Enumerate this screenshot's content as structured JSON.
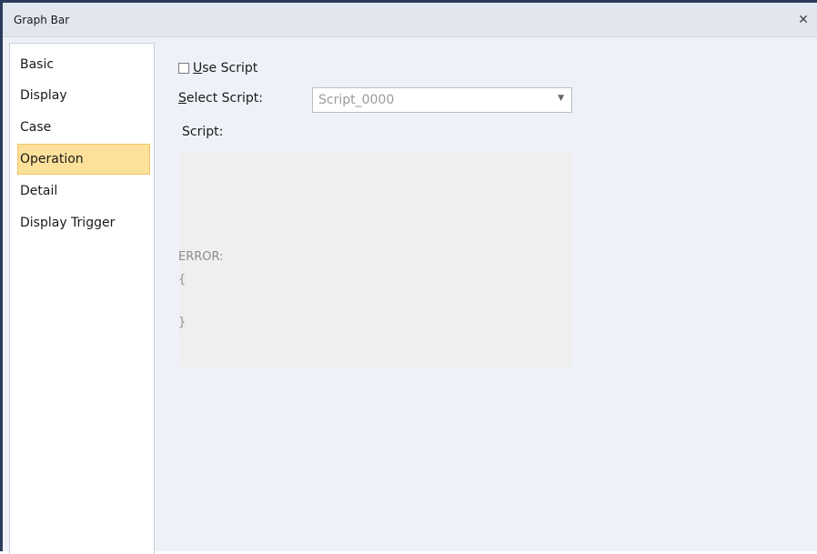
{
  "window": {
    "title": "Graph Bar",
    "close_glyph": "✕"
  },
  "sidebar": {
    "items": [
      {
        "label": "Basic",
        "active": false
      },
      {
        "label": "Display",
        "active": false
      },
      {
        "label": "Case",
        "active": false
      },
      {
        "label": "Operation",
        "active": true
      },
      {
        "label": "Detail",
        "active": false
      },
      {
        "label": "Display Trigger",
        "active": false
      }
    ]
  },
  "operation": {
    "use_script": {
      "mnemonic": "U",
      "rest": "se Script",
      "checked": false
    },
    "select_script": {
      "mnemonic": "S",
      "rest": "elect Script:",
      "value": "Script_0000",
      "arrow": "▼"
    },
    "script_label": "Script:",
    "script_lines": [
      "ERROR:",
      "{",
      "}"
    ]
  },
  "colors": {
    "accent_border": "#2b3b5c",
    "active_item_bg": "#fde19a",
    "panel_bg": "#eef1f7"
  }
}
